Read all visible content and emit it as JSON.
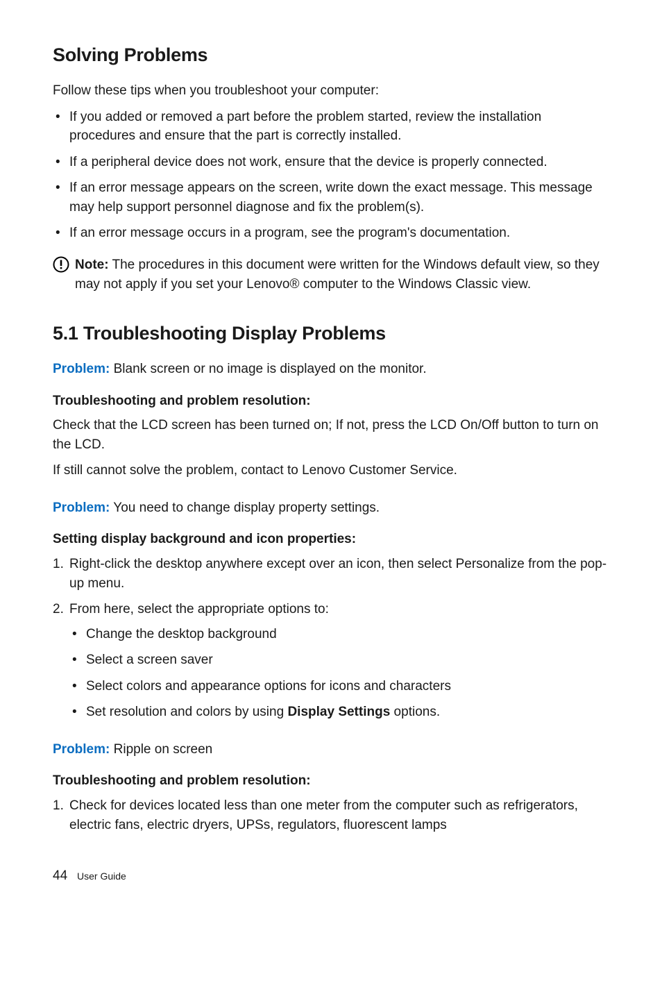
{
  "heading_solving": "Solving Problems",
  "intro_1": "Follow these tips when you troubleshoot your computer:",
  "tips": [
    "If you added or removed a part before the problem started, review the installation procedures and ensure that the part is correctly installed.",
    "If a peripheral device does not work, ensure that the device is properly connected.",
    "If an error message appears on the screen, write down the exact message. This message may help support personnel diagnose and fix the problem(s).",
    "If an error message occurs in a program, see the program's documentation."
  ],
  "note_label": "Note:",
  "note_body": " The procedures in this document were written for the Windows default view, so they may not apply if you set your Lenovo® computer to the Windows Classic view.",
  "heading_section": "5.1 Troubleshooting Display Problems",
  "p1_label": "Problem:",
  "p1_body": " Blank screen or no image is displayed on the monitor.",
  "p1_sub": "Troubleshooting and problem resolution:",
  "p1_text1": "Check that the LCD screen has been turned on; If not, press the LCD On/Off button to turn on the LCD.",
  "p1_text2": "If still cannot solve the problem, contact to Lenovo Customer Service.",
  "p2_label": "Problem:",
  "p2_body": " You need to change display property settings.",
  "p2_sub": "Setting display background and icon properties:",
  "p2_steps": [
    "Right-click the desktop anywhere except over an icon, then select Personalize from the pop-up menu.",
    "From here, select the appropriate options to:"
  ],
  "p2_subbullets": [
    "Change the desktop background",
    "Select a screen saver",
    "Select colors and appearance options for icons and characters"
  ],
  "p2_last_pre": "Set resolution and colors by using ",
  "p2_last_bold": "Display Settings",
  "p2_last_post": " options.",
  "p3_label": "Problem:",
  "p3_body": " Ripple on screen",
  "p3_sub": "Troubleshooting and problem resolution:",
  "p3_steps": [
    "Check for devices located less than one meter from the computer such as refrigerators, electric fans, electric dryers, UPSs, regulators, fluorescent lamps"
  ],
  "footer_page": "44",
  "footer_label": "User Guide"
}
